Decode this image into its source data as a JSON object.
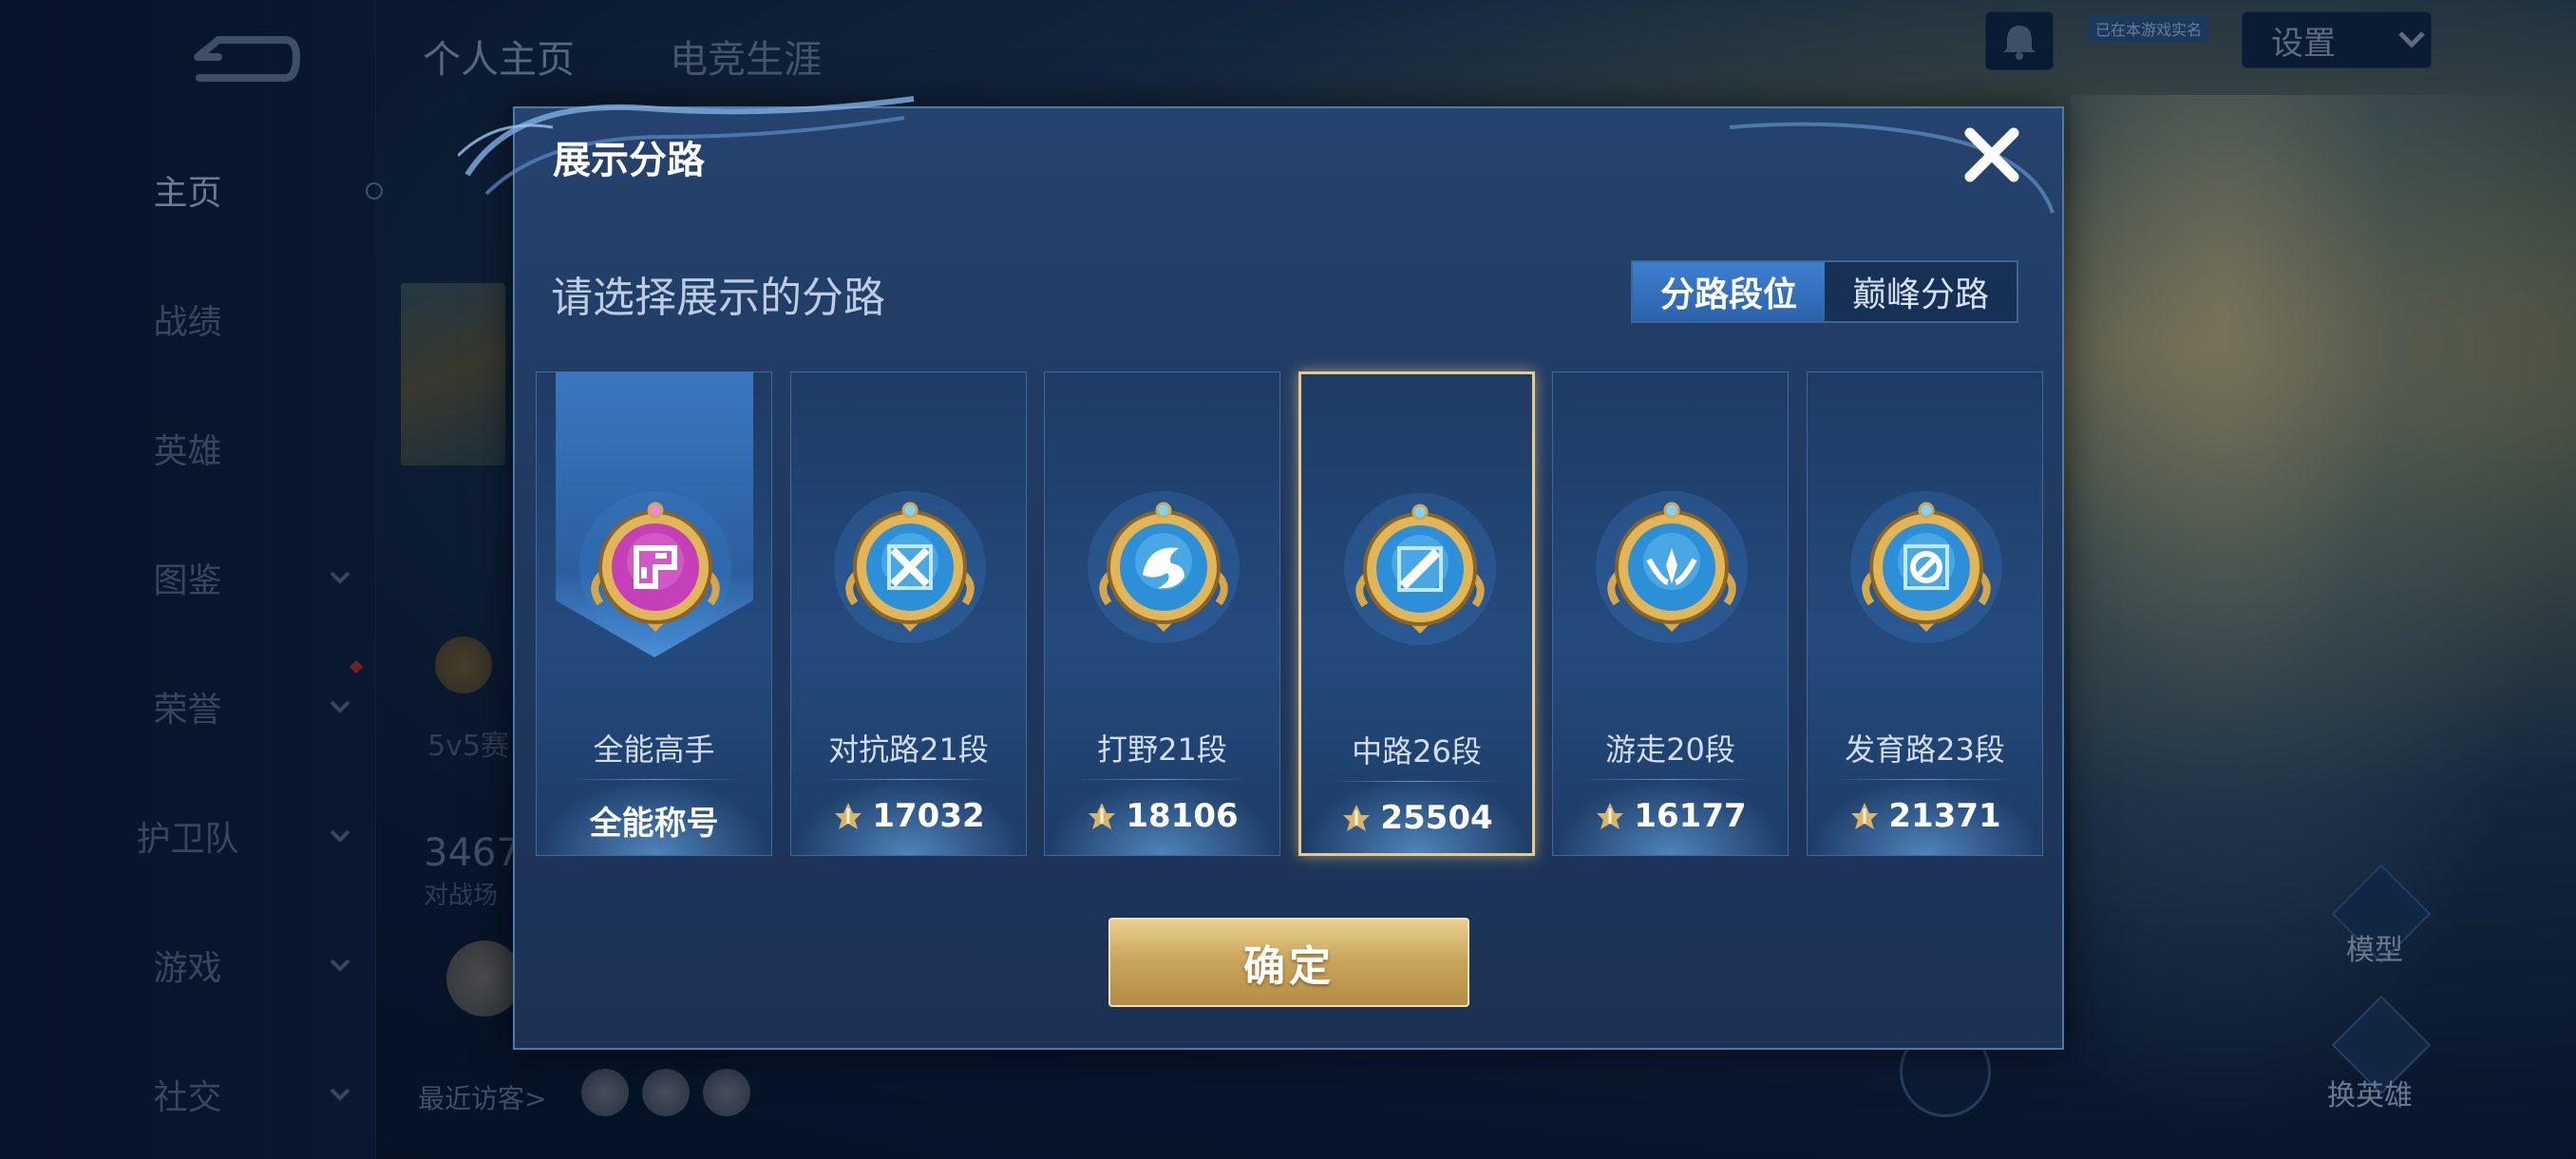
{
  "background": {
    "sidebar": {
      "items": [
        {
          "label": "主页",
          "has_chevron": false,
          "active": true
        },
        {
          "label": "战绩",
          "has_chevron": false
        },
        {
          "label": "英雄",
          "has_chevron": false
        },
        {
          "label": "图鉴",
          "has_chevron": true
        },
        {
          "label": "荣誉",
          "has_chevron": true
        },
        {
          "label": "护卫队",
          "has_chevron": true
        },
        {
          "label": "游戏",
          "has_chevron": true
        },
        {
          "label": "社交",
          "has_chevron": true
        }
      ]
    },
    "top_tabs": [
      "个人主页",
      "电竞生涯"
    ],
    "verify_badge": "已在本游戏实名",
    "settings_label": "设置",
    "mode_text": "5v5赛",
    "stat_number": "3467",
    "stat_label": "对战场",
    "recent_visitors_label": "最近访客>",
    "model_label": "模型",
    "change_hero_label": "换英雄"
  },
  "dialog": {
    "title": "展示分路",
    "subtitle": "请选择展示的分路",
    "segment": {
      "options": [
        "分路段位",
        "巅峰分路"
      ],
      "selected_index": 0
    },
    "cards": [
      {
        "name": "全能高手",
        "value": "全能称号",
        "emblem": "all-round-emblem",
        "has_value_icon": false
      },
      {
        "name": "对抗路21段",
        "value": "17032",
        "emblem": "clash-lane-emblem",
        "has_value_icon": true
      },
      {
        "name": "打野21段",
        "value": "18106",
        "emblem": "jungle-emblem",
        "has_value_icon": true
      },
      {
        "name": "中路26段",
        "value": "25504",
        "emblem": "mid-lane-emblem",
        "has_value_icon": true,
        "selected": true
      },
      {
        "name": "游走20段",
        "value": "16177",
        "emblem": "roam-emblem",
        "has_value_icon": true
      },
      {
        "name": "发育路23段",
        "value": "21371",
        "emblem": "farm-lane-emblem",
        "has_value_icon": true
      }
    ],
    "confirm_label": "确定"
  },
  "colors": {
    "dialog_bg": "#20395f",
    "selected_border": "#e9c98a",
    "confirm_gold": "#c8a35a",
    "segment_active": "#3f7fd0"
  }
}
